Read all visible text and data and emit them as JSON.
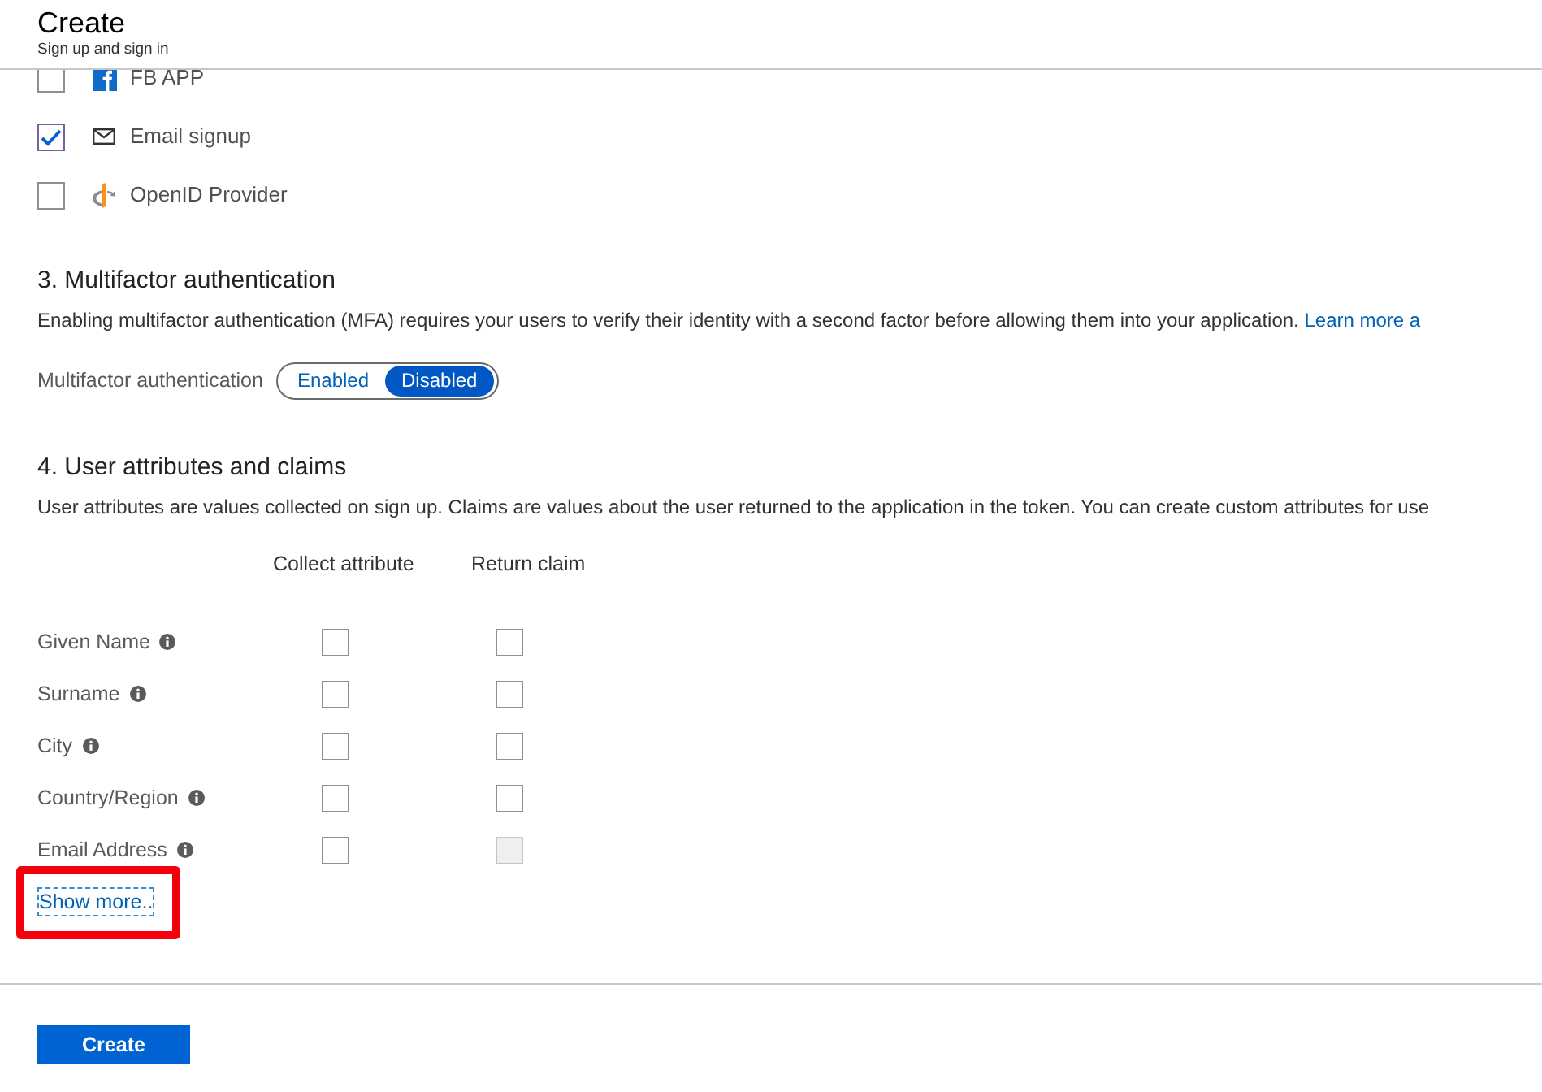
{
  "header": {
    "title": "Create",
    "subtitle": "Sign up and sign in"
  },
  "identity_providers": [
    {
      "label": "FB APP",
      "kind": "facebook",
      "checked": false
    },
    {
      "label": "Email signup",
      "kind": "email",
      "checked": true
    },
    {
      "label": "OpenID Provider",
      "kind": "openid",
      "checked": false
    }
  ],
  "mfa_section": {
    "heading": "3. Multifactor authentication",
    "description": "Enabling multifactor authentication (MFA) requires your users to verify their identity with a second factor before allowing them into your application.",
    "link": "Learn more a",
    "field_label": "Multifactor authentication",
    "options": [
      {
        "label": "Enabled",
        "selected": false
      },
      {
        "label": "Disabled",
        "selected": true
      }
    ]
  },
  "attributes_section": {
    "heading": "4. User attributes and claims",
    "description": "User attributes are values collected on sign up. Claims are values about the user returned to the application in the token. You can create custom attributes for use",
    "columns": [
      "Collect attribute",
      "Return claim"
    ],
    "rows": [
      {
        "name": "Given Name",
        "collect": {
          "checked": false,
          "disabled": false
        },
        "return": {
          "checked": false,
          "disabled": false
        }
      },
      {
        "name": "Surname",
        "collect": {
          "checked": false,
          "disabled": false
        },
        "return": {
          "checked": false,
          "disabled": false
        }
      },
      {
        "name": "City",
        "collect": {
          "checked": false,
          "disabled": false
        },
        "return": {
          "checked": false,
          "disabled": false
        }
      },
      {
        "name": "Country/Region",
        "collect": {
          "checked": false,
          "disabled": false
        },
        "return": {
          "checked": false,
          "disabled": false
        }
      },
      {
        "name": "Email Address",
        "collect": {
          "checked": false,
          "disabled": false
        },
        "return": {
          "checked": false,
          "disabled": true
        }
      }
    ],
    "show_more": {
      "label": "Show more..",
      "focused": true,
      "highlighted": true
    }
  },
  "footer": {
    "button": "Create"
  }
}
